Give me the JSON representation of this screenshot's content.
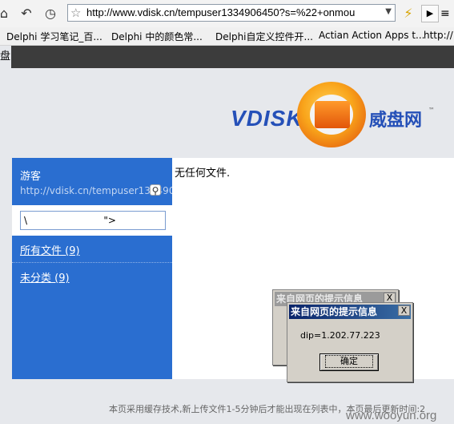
{
  "browser": {
    "url": "http://www.vdisk.cn/tempuser1334906450?s=%22+onmou",
    "icons": {
      "home": "home-icon",
      "back": "back-icon",
      "history": "history-icon",
      "star": "star-icon",
      "bolt": "lightning-icon",
      "play": "play-icon",
      "menu": "menu-icon"
    },
    "bookmarks": [
      "Delphi 学习笔记_百...",
      "Delphi 中的颜色常...",
      "Delphi自定义控件开...",
      "Actian Action Apps t...",
      "http://"
    ],
    "tab_label": "盘"
  },
  "logo": {
    "text": "VDISK",
    "cn": "威盘网",
    "tm": "™"
  },
  "sidebar": {
    "username": "游客",
    "user_url": "http://vdisk.cn/tempuser1334906450",
    "search_value": "\\                         \">",
    "search_icon": "magnifier-icon",
    "items": [
      {
        "label": "所有文件 (9)"
      },
      {
        "label": "未分类 (9)"
      }
    ]
  },
  "main": {
    "empty_message": "无任何文件."
  },
  "footer": {
    "text": "本页采用缓存技术,新上传文件1-5分钟后才能出现在列表中，本页最后更新时间:2",
    "watermark": "www.wooyun.org"
  },
  "dialogs": {
    "back": {
      "title": "来自网页的提示信息",
      "close": "X"
    },
    "front": {
      "title": "来自网页的提示信息",
      "close": "X",
      "message": "dip=1.202.77.223",
      "ok_label": "确定"
    }
  },
  "colors": {
    "sidebar": "#2a6ed0",
    "logo_blue": "#2550b8",
    "logo_orange": "#f9a51b",
    "dialog_title": "#0a246a"
  }
}
